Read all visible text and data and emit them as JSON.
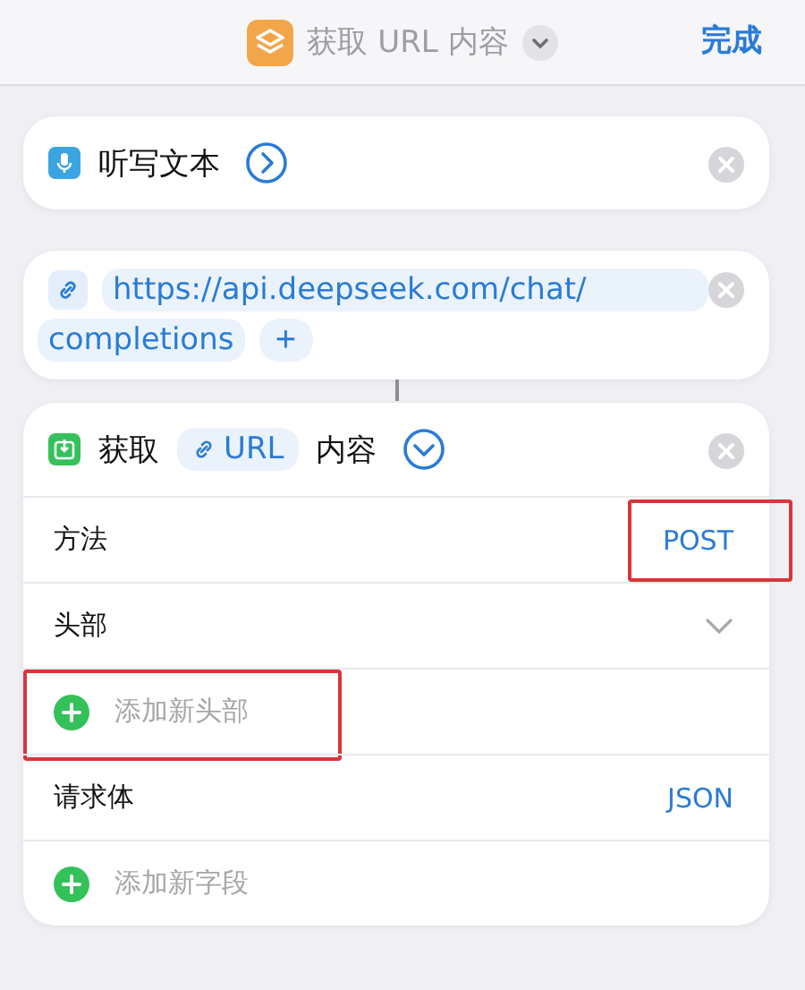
{
  "top_bar": {
    "title": "获取 URL 内容",
    "done": "完成"
  },
  "dictate_action": {
    "title": "听写文本",
    "expanded": false
  },
  "url_action": {
    "lines": [
      "https://api.deepseek.com/chat/",
      "completions"
    ],
    "add": "+"
  },
  "get_action": {
    "verb": "获取",
    "token": "URL",
    "noun": "内容",
    "expanded": true,
    "rows": [
      {
        "kind": "value",
        "label": "方法",
        "value": "POST",
        "highlighted": true
      },
      {
        "kind": "disclosure",
        "label": "头部",
        "highlighted": false
      },
      {
        "kind": "add",
        "label": "添加新头部",
        "highlighted": true
      },
      {
        "kind": "value",
        "label": "请求体",
        "value": "JSON",
        "highlighted": false
      },
      {
        "kind": "add",
        "label": "添加新字段",
        "highlighted": false
      }
    ]
  }
}
